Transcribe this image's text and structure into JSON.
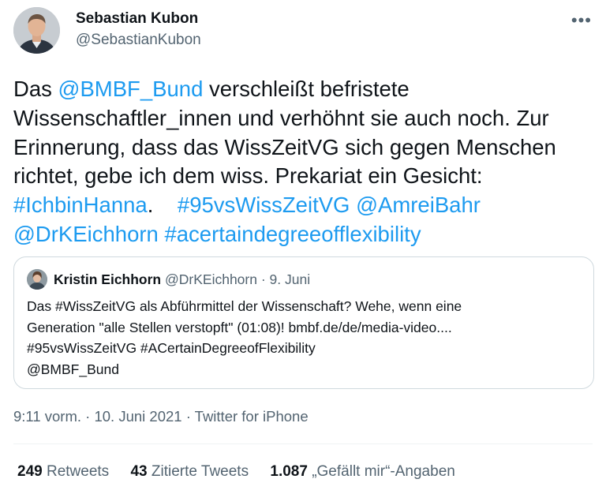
{
  "author": {
    "name": "Sebastian Kubon",
    "handle": "@SebastianKubon"
  },
  "more_icon": "more-horizontal-icon",
  "tweet": {
    "line1": {
      "pre": "Das ",
      "mention": "@BMBF_Bund",
      "post": " verschleißt befristete"
    },
    "line2": "Wissenschaftler_innen und verhöhnt sie auch noch. Zur",
    "line3": "Erinnerung, dass das WissZeitVG sich gegen Menschen",
    "line4": "richtet, gebe ich dem wiss. Prekariat ein Gesicht:",
    "line5": {
      "tag1": "#IchbinHanna",
      "sep": ".    ",
      "tag2": "#95vsWissZeitVG",
      "mention": "@AmreiBahr"
    },
    "line6": {
      "mention": "@DrKEichhorn",
      "tag": "#acertaindegreeofflexibility"
    }
  },
  "quote": {
    "name": "Kristin Eichhorn",
    "handle": "@DrKEichhorn",
    "date": "· 9. Juni",
    "lines": [
      "Das #WissZeitVG als Abführmittel der Wissenschaft? Wehe, wenn eine",
      "Generation \"alle Stellen verstopft\" (01:08)! bmbf.de/de/media-video....",
      "#95vsWissZeitVG #ACertainDegreeofFlexibility",
      "@BMBF_Bund"
    ]
  },
  "timestamp": "9:11 vorm. · 10. Juni 2021 · Twitter for iPhone",
  "stats": {
    "retweets": {
      "count": "249",
      "label": "Retweets"
    },
    "quotes": {
      "count": "43",
      "label": "Zitierte Tweets"
    },
    "likes": {
      "count": "1.087",
      "label": "„Gefällt mir“-Angaben"
    }
  },
  "colors": {
    "link": "#1d9bf0",
    "secondary": "#536471",
    "border": "#cfd9de"
  }
}
